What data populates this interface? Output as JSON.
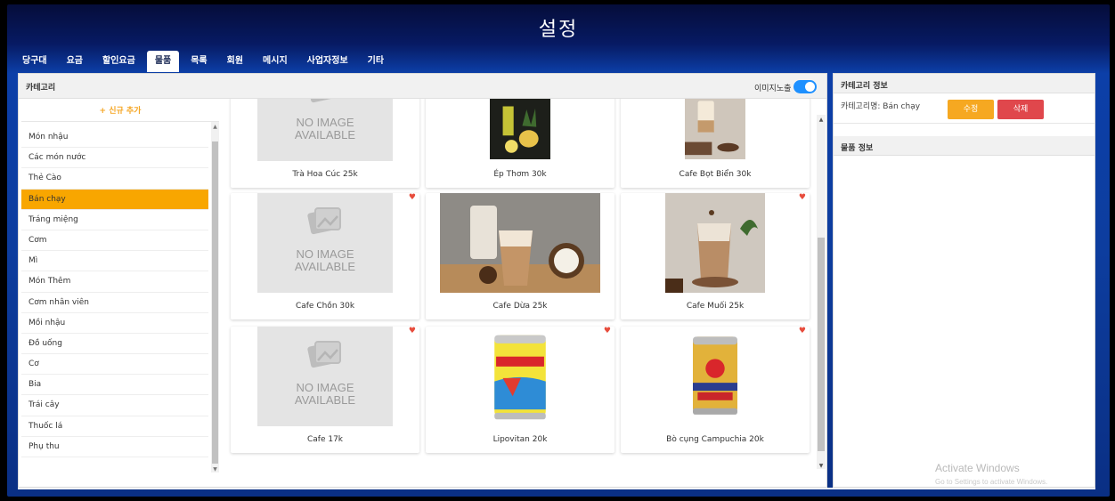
{
  "window": {
    "title": "설정"
  },
  "tabs": [
    "당구대",
    "요금",
    "할인요금",
    "물품",
    "목록",
    "회원",
    "메시지",
    "사업자정보",
    "기타"
  ],
  "left_panel": {
    "header_label": "카테고리",
    "image_toggle_label": "이미지노출",
    "add_new_label": "+ 신규 추가",
    "categories": [
      "Món nhậu",
      "Các món nước",
      "Thẻ Cào",
      "Bán chạy",
      "Tráng miệng",
      "Cơm",
      "Mì",
      "Món Thêm",
      "Cơm nhân viên",
      "Mồi nhậu",
      "Đồ uống",
      "Cơ",
      "Bia",
      "Trái cây",
      "Thuốc lá",
      "Phụ thu"
    ],
    "selected_category": "Bán chạy"
  },
  "products": [
    {
      "name": "Trà Hoa Cúc 25k",
      "image": "no-image"
    },
    {
      "name": "Ép Thơm 30k",
      "image": "pineapple-juice"
    },
    {
      "name": "Cafe Bọt Biển 30k",
      "image": "dalgona-coffee"
    },
    {
      "name": "Cafe Chồn 30k",
      "image": "no-image"
    },
    {
      "name": "Cafe Dừa 25k",
      "image": "coconut-coffee"
    },
    {
      "name": "Cafe Muối 25k",
      "image": "salt-coffee"
    },
    {
      "name": "Cafe 17k",
      "image": "no-image"
    },
    {
      "name": "Lipovitan 20k",
      "image": "lipovitan-can"
    },
    {
      "name": "Bò cụng Campuchia 20k",
      "image": "redbull-can"
    }
  ],
  "no_image_text": {
    "line1": "NO IMAGE",
    "line2": "AVAILABLE"
  },
  "right_panel": {
    "category_info_title": "카테고리 정보",
    "category_name_label": "카테고리명: Bán chạy",
    "edit_button": "수정",
    "delete_button": "삭제",
    "product_info_title": "물품 정보"
  },
  "watermark": {
    "line1": "Activate Windows",
    "line2": "Go to Settings to activate Windows."
  },
  "colors": {
    "accent": "#f8a600",
    "delete": "#e0474c",
    "toggle": "#1e90ff",
    "heart": "#e74c3c"
  }
}
